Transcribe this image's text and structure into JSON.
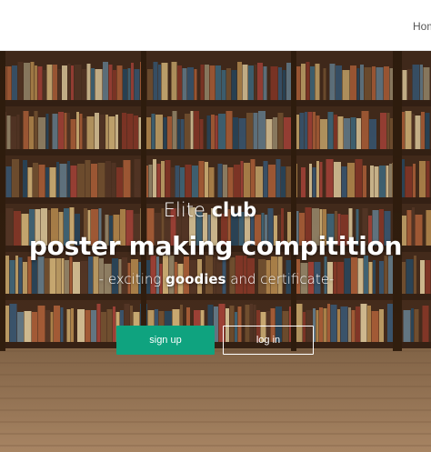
{
  "nav": {
    "home_label": "Home"
  },
  "hero": {
    "subtitle_plain": "Elite ",
    "subtitle_bold": "club",
    "title": "poster making compitition",
    "tagline_prefix": "- exciting ",
    "tagline_bold": "goodies",
    "tagline_suffix": " and certificate-",
    "signup_label": "sign up",
    "login_label": "log in"
  },
  "colors": {
    "signup_button": "#0fa37f",
    "navbar": "#ffffff"
  }
}
